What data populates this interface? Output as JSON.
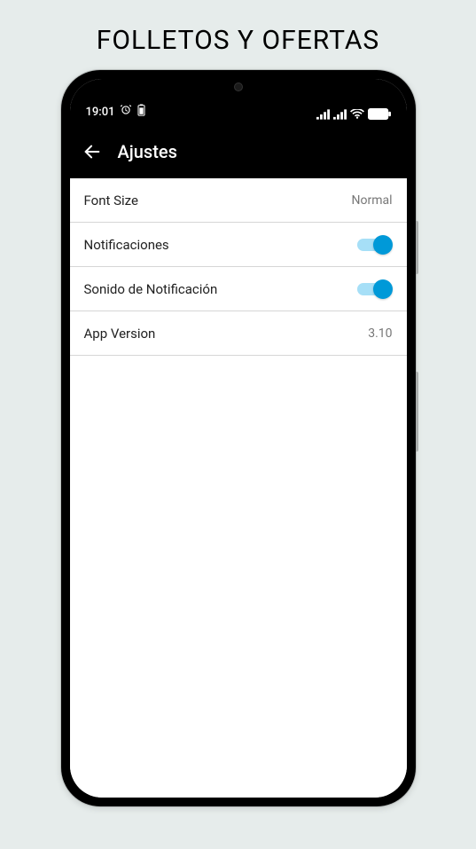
{
  "page": {
    "title": "FOLLETOS Y OFERTAS"
  },
  "status": {
    "time": "19:01"
  },
  "appbar": {
    "title": "Ajustes"
  },
  "settings": {
    "font_size": {
      "label": "Font Size",
      "value": "Normal"
    },
    "notifications": {
      "label": "Notificaciones",
      "on": true
    },
    "notif_sound": {
      "label": "Sonido de Notificación",
      "on": true
    },
    "app_version": {
      "label": "App Version",
      "value": "3.10"
    }
  }
}
